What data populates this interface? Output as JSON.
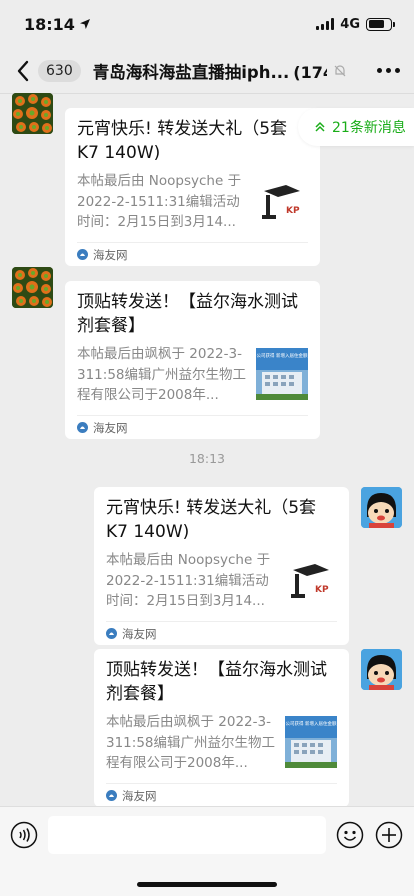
{
  "status_bar": {
    "time": "18:14",
    "network": "4G"
  },
  "nav": {
    "unread_count": "630",
    "title": "青岛海科海盐直播抽iph...",
    "member_count": "(174)"
  },
  "new_messages": {
    "label": "21条新消息"
  },
  "messages": [
    {
      "sender": "other",
      "avatar_icon": "coral-avatar-icon",
      "title": "元宵快乐! 转发送大礼（5套K7 140W)",
      "desc": "本帖最后由 Noopsyche 于 2022-2-1511:31编辑活动时间：2月15日到3月14...",
      "thumb_icon": "aquarium-light-thumbnail",
      "thumb_text": "KP",
      "source": "海友网"
    },
    {
      "sender": "other",
      "avatar_icon": "coral-avatar-icon",
      "title": "顶贴转发送！【益尔海水测试剂套餐】",
      "desc": "本帖最后由飒枫于 2022-3-311:58编辑广州益尔生物工程有限公司于2008年...",
      "thumb_icon": "company-building-thumbnail",
      "thumb_text": "公司获得\n新增入居住金额",
      "source": "海友网"
    },
    {
      "sender": "self",
      "avatar_icon": "cartoon-boy-avatar-icon",
      "title": "元宵快乐! 转发送大礼（5套K7 140W)",
      "desc": "本帖最后由 Noopsyche 于 2022-2-1511:31编辑活动时间：2月15日到3月14...",
      "thumb_icon": "aquarium-light-thumbnail",
      "thumb_text": "KP",
      "source": "海友网"
    },
    {
      "sender": "self",
      "avatar_icon": "cartoon-boy-avatar-icon",
      "title": "顶贴转发送！【益尔海水测试剂套餐】",
      "desc": "本帖最后由飒枫于 2022-3-311:58编辑广州益尔生物工程有限公司于2008年...",
      "thumb_icon": "company-building-thumbnail",
      "thumb_text": "公司获得\n新增入居住金额",
      "source": "海友网"
    }
  ],
  "time_divider": "18:13",
  "input": {
    "value": ""
  },
  "colors": {
    "background": "#ededed",
    "accent_green": "#1aad19",
    "card": "#ffffff"
  }
}
